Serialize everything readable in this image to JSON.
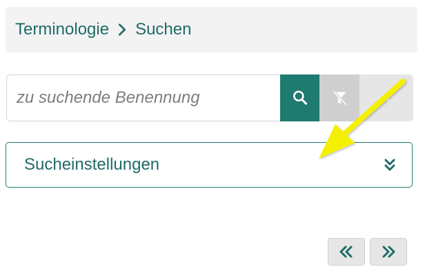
{
  "breadcrumb": {
    "items": [
      {
        "label": "Terminologie"
      },
      {
        "label": "Suchen"
      }
    ],
    "separator_icon": "chevron-right-icon"
  },
  "search": {
    "placeholder": "zu suchende Benennung",
    "value": "",
    "search_button_icon": "search-icon",
    "filter_button_icon": "filter-off-icon",
    "third_button_icon": "caret-left-icon"
  },
  "settings": {
    "label": "Sucheinstellungen",
    "expand_icon": "chevrons-down-icon"
  },
  "pager": {
    "prev_icon": "chevrons-left-icon",
    "next_icon": "chevrons-right-icon",
    "prev_label": "«",
    "next_label": "»"
  },
  "colors": {
    "accent": "#1f7a70",
    "text": "#1f6b66",
    "annotation_arrow": "#f5f000"
  }
}
